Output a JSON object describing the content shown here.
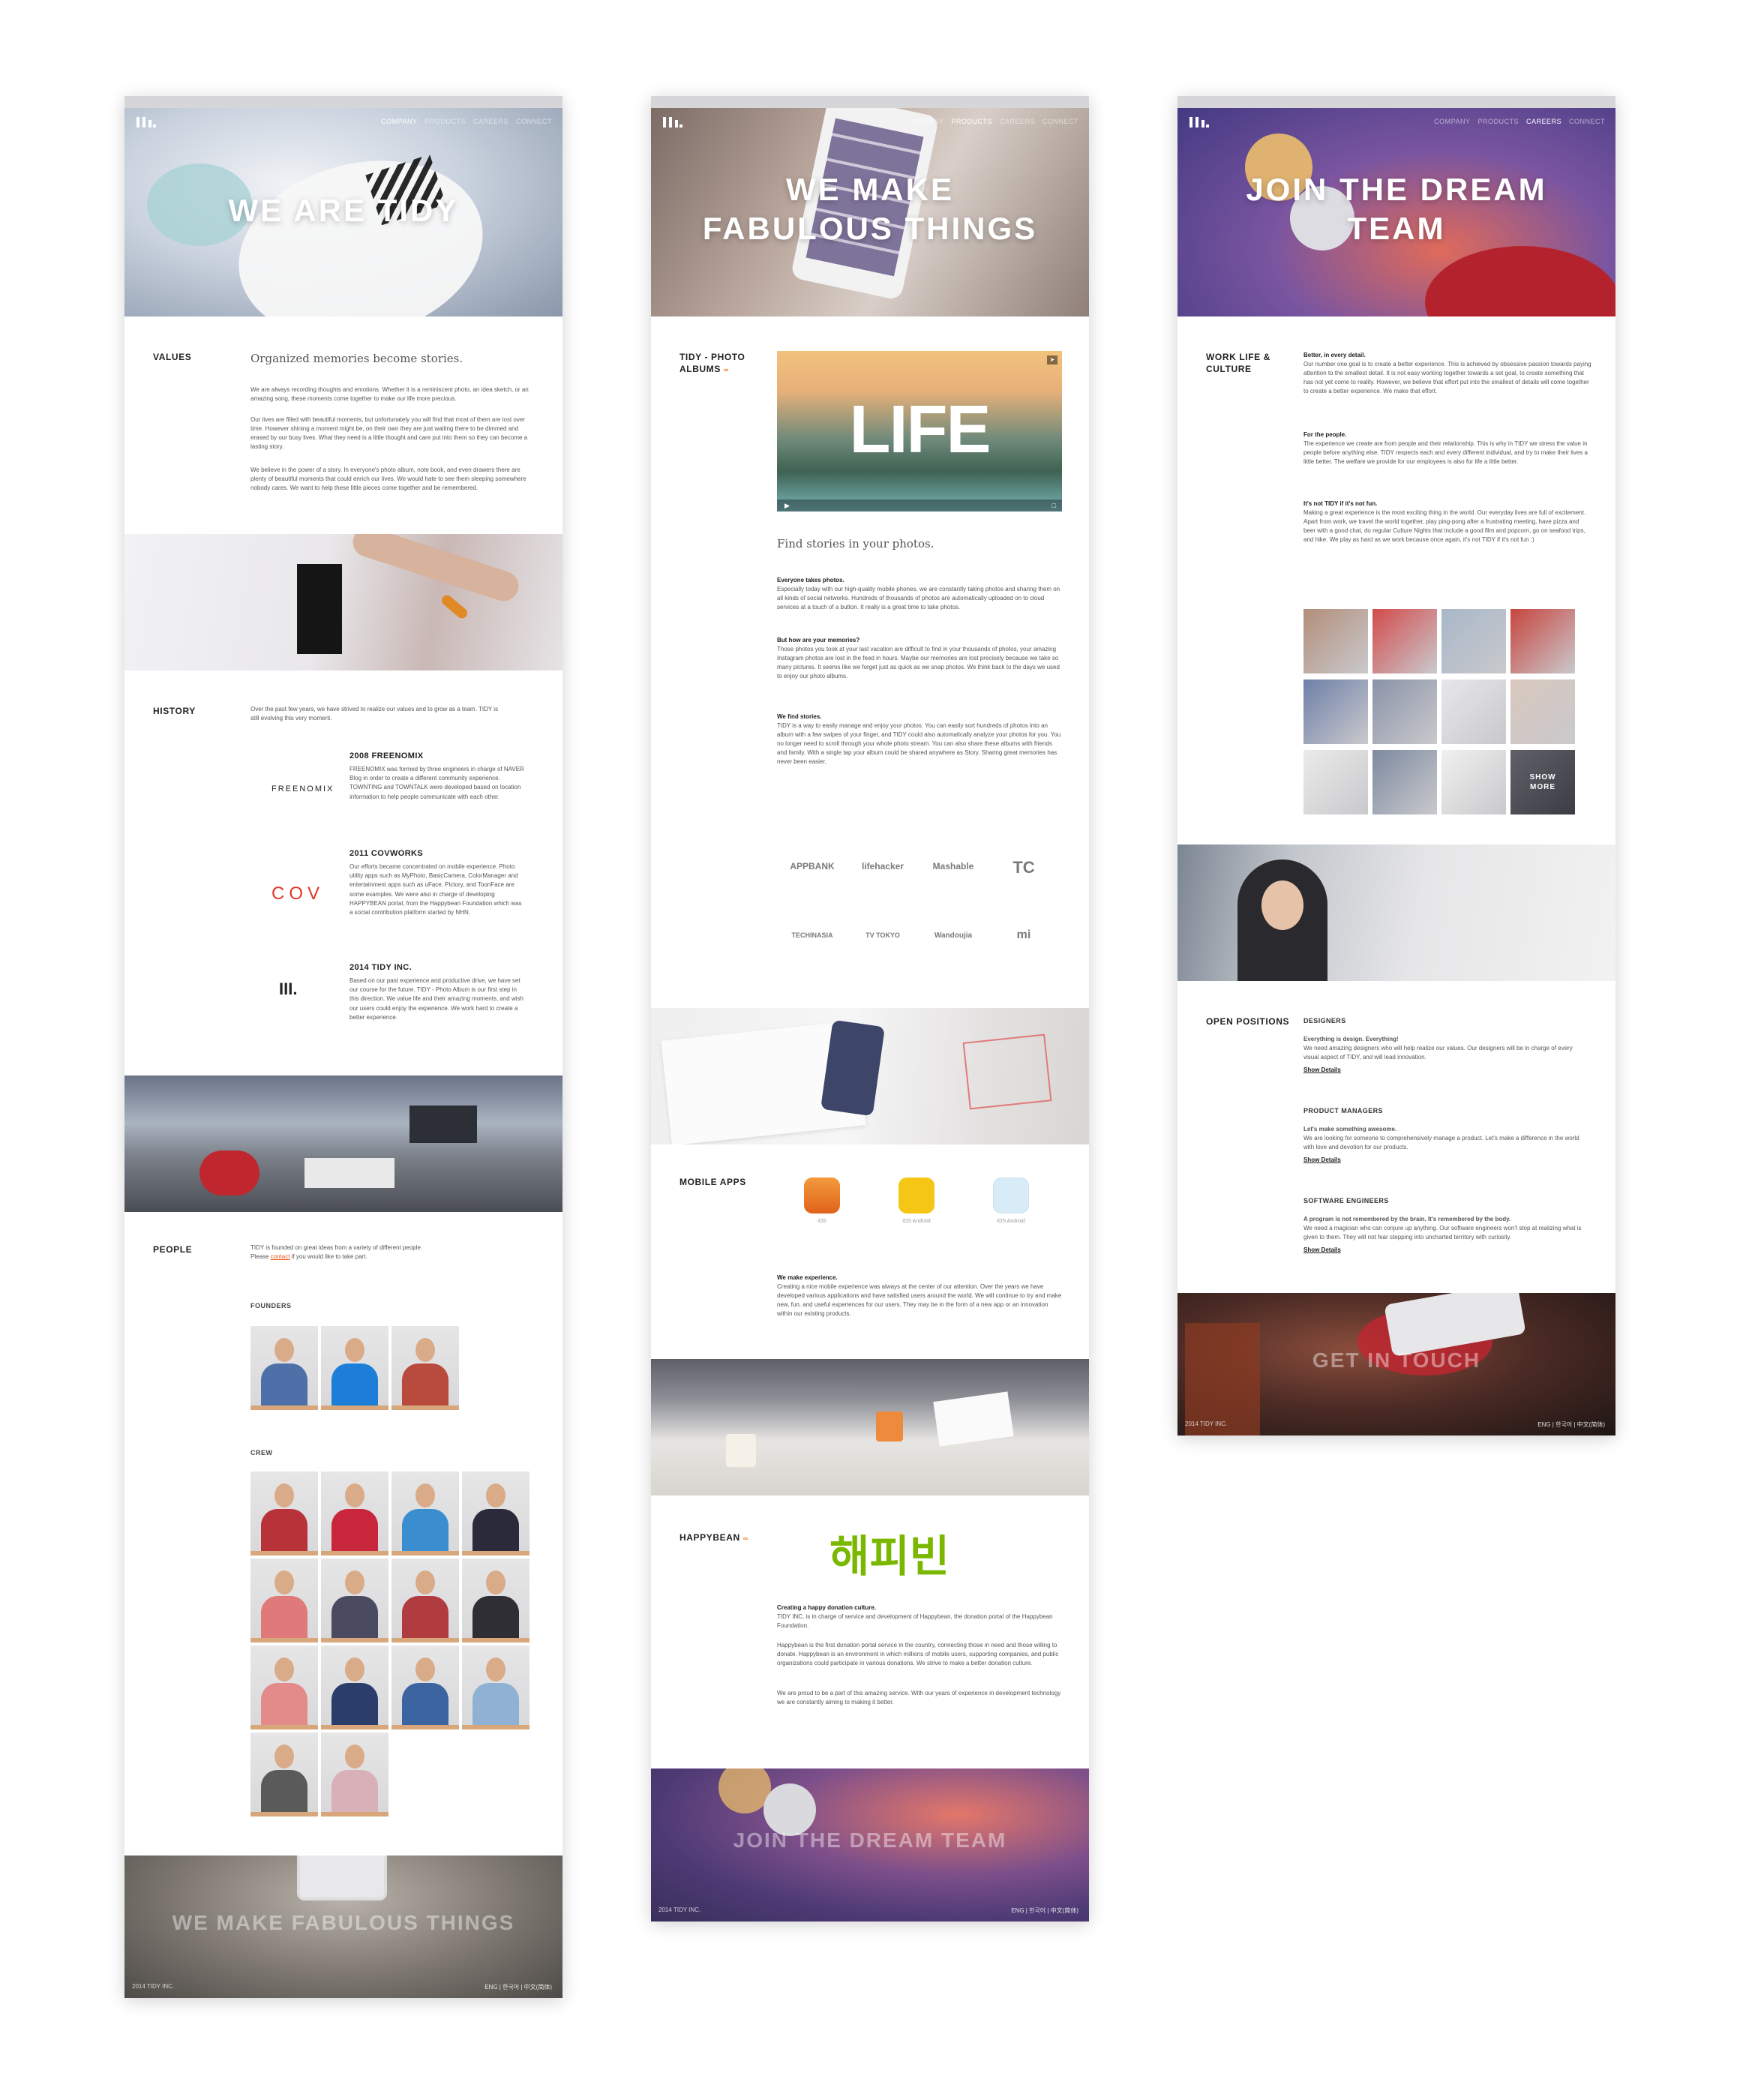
{
  "nav": {
    "links": [
      "COMPANY",
      "PRODUCTS",
      "CAREERS",
      "CONNECT"
    ]
  },
  "company": {
    "hero_title": "WE ARE TIDY",
    "values": {
      "title": "VALUES",
      "lead": "Organized memories become stories.",
      "p1": "We are always recording thoughts and emotions. Whether it is a reminiscent photo, an idea sketch, or an amazing song, these moments come together to make our life more precious.",
      "p2": "Our lives are filled with beautiful moments, but unfortunately you will find that most of them are lost over time. However shining a moment might be, on their own they are just waiting there to be dimmed and erased by our busy lives. What they need is a little thought and care put into them so they can become a lasting story.",
      "p3": "We believe in the power of a story. In everyone's photo album, note book, and even drawers there are plenty of beautiful moments that could enrich our lives. We would hate to see them sleeping somewhere nobody cares. We want to help these little pieces come together and be remembered."
    },
    "history": {
      "title": "HISTORY",
      "intro": "Over the past few years, we have strived to realize our values and to grow as a team. TIDY is still evolving this very moment.",
      "items": [
        {
          "logo": "FREENOMIX",
          "title": "2008 FREENOMIX",
          "body": "FREENOMIX was formed by three engineers in charge of NAVER Blog in order to create a different community experience. TOWNTING and TOWNTALK were developed based on location information to help people communicate with each other."
        },
        {
          "logo": "COV",
          "title": "2011 COVWORKS",
          "body": "Our efforts became concentrated on mobile experience. Photo utility apps such as MyPhoto, BasicCamera, ColorManager and entertainment apps such as uFace, Pictory, and ToonFace are some examples. We were also in charge of developing HAPPYBEAN portal, from the Happybean Foundation which was a social contribution platform started by NHN."
        },
        {
          "logo": "III.",
          "title": "2014 TIDY INC.",
          "body": "Based on our past experience and productive drive, we have set our course for the future. TIDY - Photo Album is our first step in this direction. We value life and their amazing moments, and wish our users could enjoy the experience. We work hard to create a better experience."
        }
      ]
    },
    "people": {
      "title": "PEOPLE",
      "intro_a": "TIDY is founded on great ideas from a variety of different people.",
      "intro_b_prefix": "Please ",
      "intro_b_link": "contact",
      "intro_b_suffix": " if you would like to take part.",
      "founders_label": "FOUNDERS",
      "crew_label": "CREW",
      "founders_shirts": [
        "#4e6fa8",
        "#1c7ed6",
        "#b84a3e"
      ],
      "crew_shirts": [
        "#b8323a",
        "#c8263a",
        "#3a8ed0",
        "#2a2a3a",
        "#e07a7a",
        "#4a4a60",
        "#b13c40",
        "#2e2e34",
        "#e38a8a",
        "#2b3d6a",
        "#3c64a0",
        "#8fb2d4",
        "#5a5a5a",
        "#d8b0b8"
      ]
    },
    "footer_cta": "WE MAKE FABULOUS THINGS",
    "footer_copy": "2014 TIDY INC.",
    "footer_lang": "ENG | 한국어 | 中文(简体)"
  },
  "products": {
    "hero_title_1": "WE MAKE",
    "hero_title_2": "FABULOUS THINGS",
    "album": {
      "title_1": "TIDY - PHOTO",
      "title_2": "ALBUMS",
      "video_word": "LIFE",
      "lead": "Find stories in your photos.",
      "p1_head": "Everyone takes photos.",
      "p1": "Especially today with our high-quality mobile phones, we are constantly taking photos and sharing them on all kinds of social networks. Hundreds of thousands of photos are automatically uploaded on to cloud services at a touch of a button. It really is a great time to take photos.",
      "p2_head": "But how are your memories?",
      "p2": "Those photos you took at your last vacation are difficult to find in your thousands of photos, your amazing Instagram photos are lost in the feed in hours. Maybe our memories are lost precisely because we take so many pictures. It seems like we forget just as quick as we snap photos. We think back to the days we used to enjoy our photo albums.",
      "p3_head": "We find stories.",
      "p3": "TIDY is a way to easily manage and enjoy your photos. You can easily sort hundreds of photos into an album with a few swipes of your finger, and TIDY could also automatically analyze your photos for you. You no longer need to scroll through your whole photo stream. You can also share these albums with friends and family. With a single tap your album could be shared anywhere as Story. Sharing great memories has never been easier.",
      "media": [
        "APPBANK",
        "lifehacker",
        "Mashable",
        "TC",
        "TECHINASIA",
        "TV TOKYO",
        "Wandoujia",
        "mi"
      ]
    },
    "apps": {
      "title": "MOBILE APPS",
      "items": [
        {
          "cap": "iOS",
          "color": "#e8731c"
        },
        {
          "cap": "iOS Android",
          "color": "#f6c617"
        },
        {
          "cap": "iOS Android",
          "color": "#cfe6f5"
        }
      ],
      "p_head": "We make experience.",
      "p": "Creating a nice mobile experience was always at the center of our attention. Over the years we have developed various applications and have satisfied users around the world. We will continue to try and make new, fun, and useful experiences for our users. They may be in the form of a new app or an innovation within our existing products."
    },
    "happybean": {
      "title": "HAPPYBEAN",
      "logo": "해피빈",
      "p1_head": "Creating a happy donation culture.",
      "p1": "TIDY INC. is in charge of service and development of Happybean, the donation portal of the Happybean Foundation.",
      "p2": "Happybean is the first donation portal service in the country, connecting those in need and those willing to donate. Happybean is an environment in which millions of mobile users, supporting companies, and public organizations could participate in various donations. We strive to make a better donation culture.",
      "p3": "We are proud to be a part of this amazing service. With our years of experience in development technology we are constantly aiming to making it better."
    },
    "footer_cta": "JOIN THE DREAM TEAM",
    "footer_copy": "2014 TIDY INC.",
    "footer_lang": "ENG | 한국어 | 中文(简体)"
  },
  "careers": {
    "hero_title_1": "JOIN THE DREAM",
    "hero_title_2": "TEAM",
    "culture": {
      "title_1": "WORK LIFE &",
      "title_2": "CULTURE",
      "h1": "Better, in every detail.",
      "p1": "Our number one goal is to create a better experience. This is achieved by obsessive passion towards paying attention to the smallest detail. It is not easy working together towards a set goal, to create something that has not yet come to reality. However, we believe that effort put into the smallest of details will come together to create a better experience. We make that effort.",
      "h2": "For the people.",
      "p2": "The experience we create are from people and their relationship. This is why in TIDY we stress the value in people before anything else. TIDY respects each and every different individual, and try to make their lives a little better. The welfare we provide for our employees is also for life a little better.",
      "h3": "It's not TIDY if it's not fun.",
      "p3": "Making a great experience is the most exciting thing in the world. Our everyday lives are full of excitement. Apart from work, we travel the world together, play ping-pong after a frustrating meeting, have pizza and beer with a good chat, do regular Culture Nights that include a good film and popcorn, go on seafood trips, and hike. We play as hard as we work because once again, it's not TIDY if it's not fun :)",
      "show_more": "SHOW MORE"
    },
    "positions": {
      "title": "OPEN POSITIONS",
      "show_details": "Show Details",
      "items": [
        {
          "title": "DESIGNERS",
          "head": "Everything is design. Everything!",
          "body": "We need amazing designers who will help realize our values. Our designers will be in charge of every visual aspect of TIDY, and will lead innovation."
        },
        {
          "title": "PRODUCT MANAGERS",
          "head": "Let's make something awesome.",
          "body": "We are looking for someone to comprehensively manage a product. Let's make a difference in the world with love and devotion for our products."
        },
        {
          "title": "SOFTWARE ENGINEERS",
          "head": "A program is not remembered by the brain. It's remembered by the body.",
          "body": "We need a magician who can conjure up anything. Our software engineers won't stop at realizing what is given to them. They will not fear stepping into uncharted territory with curiosity."
        }
      ]
    },
    "footer_cta": "GET IN TOUCH",
    "footer_copy": "2014 TIDY INC.",
    "footer_lang": "ENG | 한국어 | 中文(简体)"
  }
}
